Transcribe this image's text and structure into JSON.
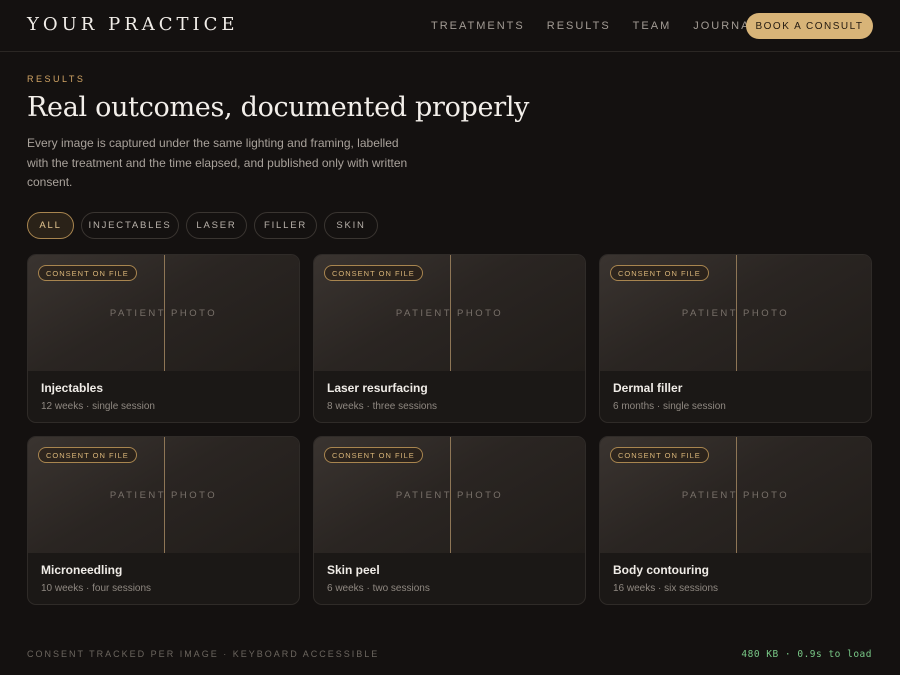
{
  "header": {
    "logo": "YOUR PRACTICE",
    "nav": [
      "TREATMENTS",
      "RESULTS",
      "TEAM",
      "JOURNAL"
    ],
    "cta": "BOOK A CONSULT"
  },
  "hero": {
    "eyebrow": "RESULTS",
    "title": "Real outcomes, documented properly",
    "lede": "Every image is captured under the same lighting and framing, labelled with the treatment and the time elapsed, and published only with written consent."
  },
  "filters": {
    "active": "ALL",
    "items": [
      "ALL",
      "INJECTABLES",
      "LASER",
      "FILLER",
      "SKIN"
    ]
  },
  "cards": [
    {
      "badge": "CONSENT ON FILE",
      "photo_label": "PATIENT PHOTO",
      "title": "Injectables",
      "meta": "12 weeks · single session"
    },
    {
      "badge": "CONSENT ON FILE",
      "photo_label": "PATIENT PHOTO",
      "title": "Laser resurfacing",
      "meta": "8 weeks · three sessions"
    },
    {
      "badge": "CONSENT ON FILE",
      "photo_label": "PATIENT PHOTO",
      "title": "Dermal filler",
      "meta": "6 months · single session"
    },
    {
      "badge": "CONSENT ON FILE",
      "photo_label": "PATIENT PHOTO",
      "title": "Microneedling",
      "meta": "10 weeks · four sessions"
    },
    {
      "badge": "CONSENT ON FILE",
      "photo_label": "PATIENT PHOTO",
      "title": "Skin peel",
      "meta": "6 weeks · two sessions"
    },
    {
      "badge": "CONSENT ON FILE",
      "photo_label": "PATIENT PHOTO",
      "title": "Body contouring",
      "meta": "16 weeks · six sessions"
    }
  ],
  "footer": {
    "left": "CONSENT TRACKED PER IMAGE · KEYBOARD ACCESSIBLE",
    "right": "480 KB · 0.9s to load"
  },
  "colors": {
    "background": "#141110",
    "accent": "#d8b478",
    "status_green": "#79c987"
  }
}
